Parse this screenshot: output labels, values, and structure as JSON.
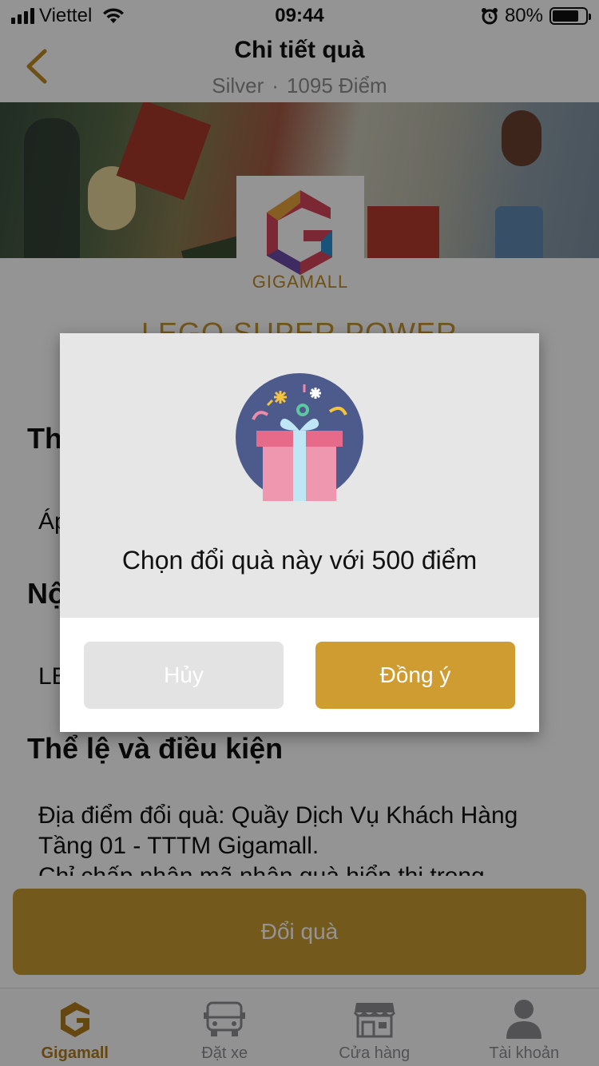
{
  "status_bar": {
    "carrier": "Viettel",
    "time": "09:44",
    "battery": "80%",
    "battery_level": 0.8
  },
  "header": {
    "title": "Chi tiết quà",
    "tier": "Silver",
    "separator": "·",
    "points": "1095 Điểm",
    "back_icon": "chevron-left-icon"
  },
  "gift": {
    "brand_logo_text": "GIGAMALL",
    "title": "LEGO SUPER POWER"
  },
  "sections": {
    "s1_heading": "Th",
    "s1_text": "Áp",
    "s2_heading": "Nộ",
    "s2_text": "LE",
    "terms_heading": "Thể lệ và điều kiện",
    "terms_line1": "Địa điểm đổi quà: Quầy Dịch Vụ Khách Hàng",
    "terms_line2": "Tầng 01 - TTTM Gigamall.",
    "terms_line3": "Chỉ chấp nhận mã nhận quà hiển thị trong"
  },
  "redeem_button": "Đổi quà",
  "tabs": [
    {
      "label": "Gigamall",
      "icon": "gigamall-logo-icon",
      "active": true
    },
    {
      "label": "Đặt xe",
      "icon": "car-icon",
      "active": false
    },
    {
      "label": "Cửa hàng",
      "icon": "store-icon",
      "active": false
    },
    {
      "label": "Tài khoản",
      "icon": "user-icon",
      "active": false
    }
  ],
  "dialog": {
    "icon": "gift-box-icon",
    "message": "Chọn đổi quà này với 500 điểm",
    "cancel": "Hủy",
    "confirm": "Đồng ý"
  },
  "colors": {
    "accent": "#cf9c32",
    "tab_active": "#b07a1c"
  }
}
